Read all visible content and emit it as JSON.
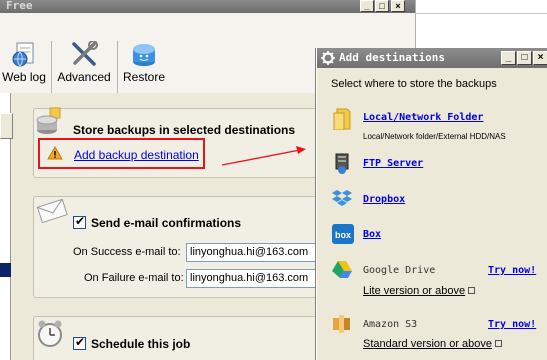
{
  "main_window": {
    "title": "Free",
    "toolbar": [
      {
        "label": "Web log",
        "icon": "web-log-icon"
      },
      {
        "label": "Advanced",
        "icon": "tools-icon"
      },
      {
        "label": "Restore",
        "icon": "restore-icon"
      }
    ],
    "backup_section": {
      "title": "Store backups in selected destinations",
      "add_link": "Add backup destination"
    },
    "email_section": {
      "title": "Send e-mail confirmations",
      "success_label": "On Success e-mail to:",
      "success_value": "linyonghua.hi@163.com",
      "failure_label": "On Failure e-mail to:",
      "failure_value": "linyonghua.hi@163.com"
    },
    "schedule_section": {
      "title": "Schedule this job"
    }
  },
  "dialog": {
    "title": "Add destinations",
    "subtitle": "Select where to store the backups",
    "destinations": [
      {
        "label": "Local/Network Folder",
        "sub": "Local/Network folder/External HDD/NAS",
        "icon": "folder-icon"
      },
      {
        "label": "FTP Server",
        "icon": "ftp-server-icon"
      },
      {
        "label": "Dropbox",
        "icon": "dropbox-icon"
      },
      {
        "label": "Box",
        "icon": "box-icon"
      },
      {
        "label": "Google Drive",
        "try": "Try now!",
        "version_link": "Lite version or above",
        "icon": "google-drive-icon"
      },
      {
        "label": "Amazon S3",
        "try": "Try now!",
        "version_link": "Standard version or above",
        "icon": "amazon-s3-icon"
      }
    ]
  },
  "colors": {
    "highlight": "#e8141c",
    "arrow": "#e8141c",
    "link": "#0000ee"
  }
}
